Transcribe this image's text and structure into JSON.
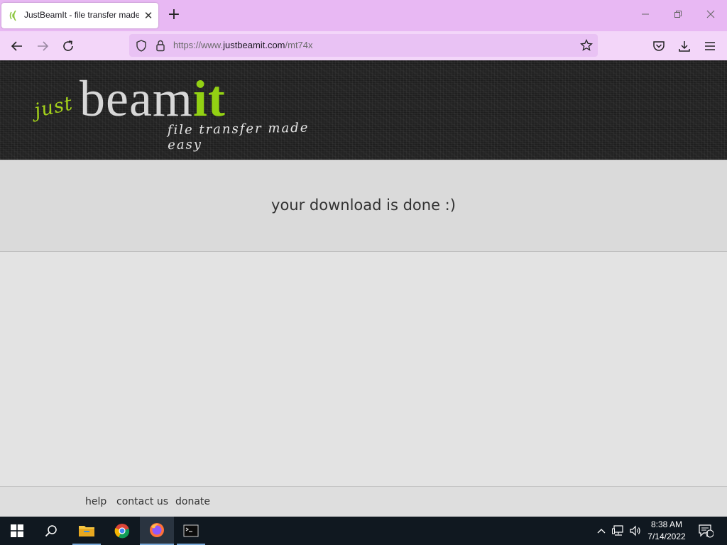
{
  "browser": {
    "tab_title": "JustBeamIt - file transfer made easy",
    "tab_close": "✕",
    "new_tab": "+",
    "url_prefix": "https://www.",
    "url_domain": "justbeamit.com",
    "url_path": "/mt74x"
  },
  "page": {
    "logo_just": "just",
    "logo_beam": "beam",
    "logo_it": "it",
    "tagline": "file transfer made easy",
    "status_message": "your download is done :)"
  },
  "footer": {
    "links": [
      "help",
      "contact us",
      "donate"
    ]
  },
  "taskbar": {
    "time": "8:38 AM",
    "date": "7/14/2022",
    "notification_count": "1"
  },
  "colors": {
    "tabbar": "#e8b8f3",
    "navbar": "#f3d6f9",
    "brand_green": "#93d113",
    "taskbar": "#101820"
  }
}
